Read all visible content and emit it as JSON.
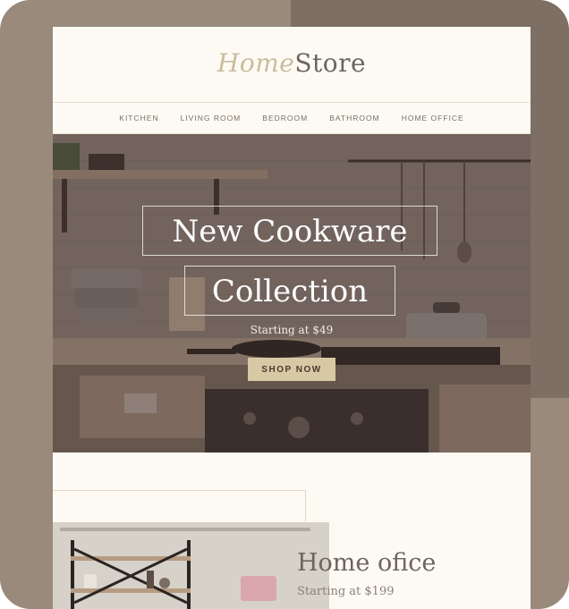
{
  "brand": {
    "logo_part1": "Home",
    "logo_part2": "Store"
  },
  "nav": {
    "items": [
      "KITCHEN",
      "LIVING ROOM",
      "BEDROOM",
      "BATHROOM",
      "HOME OFFICE"
    ]
  },
  "hero": {
    "title_line1": "New Cookware",
    "title_line2": "Collection",
    "subtitle": "Starting at $49",
    "cta_label": "SHOP NOW"
  },
  "feature": {
    "title": "Home ofice",
    "subtitle": "Starting at $199"
  },
  "colors": {
    "frame": "#9a8a7c",
    "email_bg": "#fdfaf4",
    "cta_bg": "#d8c9a5",
    "logo_accent": "#c8bd9c"
  }
}
